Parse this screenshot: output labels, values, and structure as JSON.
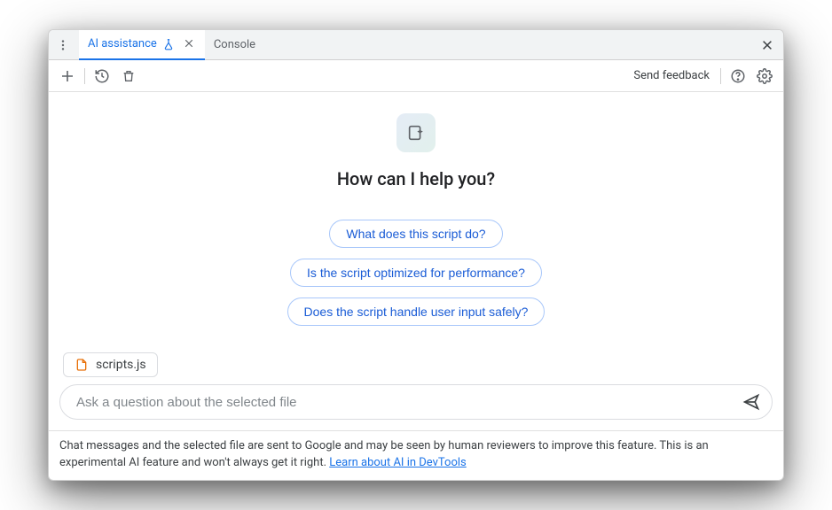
{
  "tabs": {
    "active": {
      "label": "AI assistance"
    },
    "other": [
      {
        "label": "Console"
      }
    ]
  },
  "toolbar": {
    "send_feedback_label": "Send feedback"
  },
  "hero": {
    "title": "How can I help you?"
  },
  "suggestions": [
    "What does this script do?",
    "Is the script optimized for performance?",
    "Does the script handle user input safely?"
  ],
  "context_file": {
    "name": "scripts.js"
  },
  "input": {
    "placeholder": "Ask a question about the selected file"
  },
  "disclaimer": {
    "text_before": "Chat messages and the selected file are sent to Google and may be seen by human reviewers to improve this feature. This is an experimental AI feature and won't always get it right. ",
    "link_text": "Learn about AI in DevTools"
  }
}
